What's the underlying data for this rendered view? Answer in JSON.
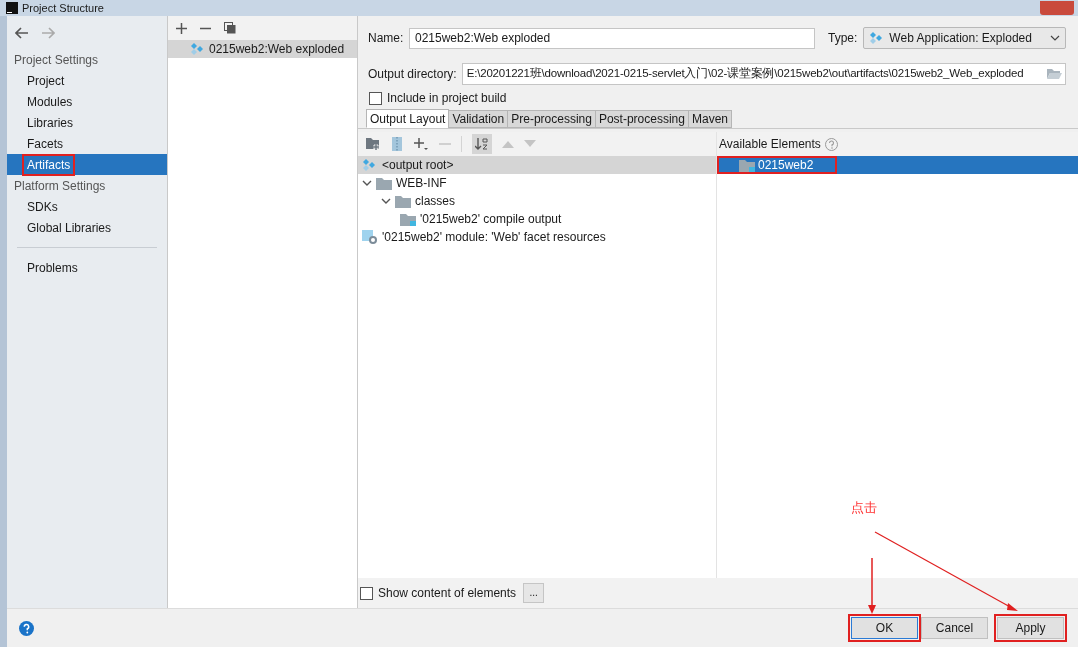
{
  "window": {
    "title": "Project Structure"
  },
  "sidebar": {
    "sections": [
      {
        "title": "Project Settings",
        "items": [
          {
            "label": "Project",
            "selected": false,
            "highlighted": false
          },
          {
            "label": "Modules",
            "selected": false,
            "highlighted": false
          },
          {
            "label": "Libraries",
            "selected": false,
            "highlighted": false
          },
          {
            "label": "Facets",
            "selected": false,
            "highlighted": false
          },
          {
            "label": "Artifacts",
            "selected": true,
            "highlighted": true
          }
        ]
      },
      {
        "title": "Platform Settings",
        "items": [
          {
            "label": "SDKs",
            "selected": false,
            "highlighted": false
          },
          {
            "label": "Global Libraries",
            "selected": false,
            "highlighted": false
          }
        ]
      }
    ],
    "footer_items": [
      {
        "label": "Problems",
        "selected": false
      }
    ]
  },
  "artifacts": {
    "items": [
      {
        "label": "0215web2:Web exploded",
        "selected": true
      }
    ]
  },
  "form": {
    "name_label": "Name:",
    "name_value": "0215web2:Web exploded",
    "type_label": "Type:",
    "type_value": "Web Application: Exploded",
    "output_label": "Output directory:",
    "output_value": "E:\\20201221班\\download\\2021-0215-servlet入门\\02-课堂案例\\0215web2\\out\\artifacts\\0215web2_Web_exploded",
    "include_label": "Include in project build",
    "include_checked": false
  },
  "tabs": [
    {
      "label": "Output Layout",
      "selected": true
    },
    {
      "label": "Validation",
      "selected": false
    },
    {
      "label": "Pre-processing",
      "selected": false
    },
    {
      "label": "Post-processing",
      "selected": false
    },
    {
      "label": "Maven",
      "selected": false
    }
  ],
  "tree": [
    {
      "label": "<output root>",
      "kind": "root",
      "selected": true
    },
    {
      "label": "WEB-INF",
      "kind": "folder",
      "selected": false,
      "expanded": true,
      "children": [
        {
          "label": "classes",
          "kind": "folder",
          "selected": false,
          "expanded": true,
          "children": [
            {
              "label": "'0215web2' compile output",
              "kind": "output",
              "selected": false
            }
          ]
        }
      ]
    },
    {
      "label": "'0215web2' module: 'Web' facet resources",
      "kind": "web",
      "selected": false
    }
  ],
  "available": {
    "title": "Available Elements",
    "items": [
      {
        "label": "0215web2",
        "selected": true,
        "highlighted": true
      }
    ]
  },
  "show_content": {
    "label": "Show content of elements",
    "checked": false,
    "button": "..."
  },
  "buttons": [
    {
      "label": "OK",
      "default": true,
      "highlighted": true
    },
    {
      "label": "Cancel",
      "default": false,
      "highlighted": false
    },
    {
      "label": "Apply",
      "default": false,
      "highlighted": true
    }
  ],
  "annotation": {
    "text": "点击"
  }
}
